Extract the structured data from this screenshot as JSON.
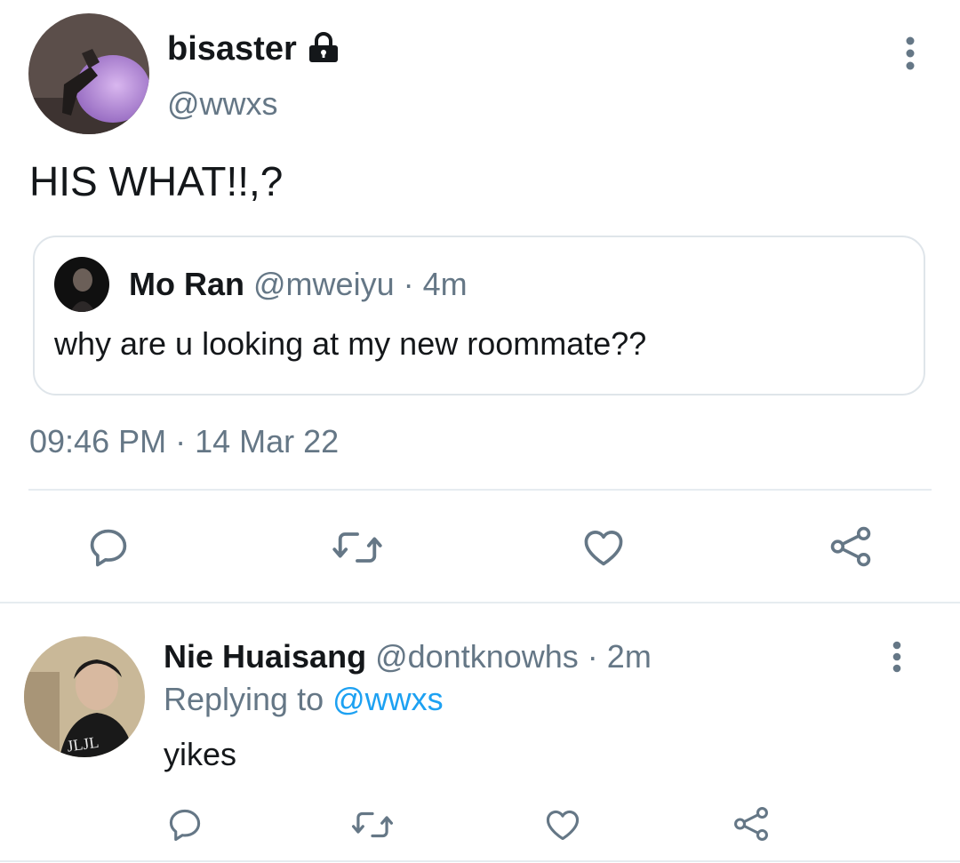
{
  "tweet": {
    "author_name": "bisaster",
    "author_handle": "@wwxs",
    "text": "HIS WHAT!!,?",
    "timestamp": "09:46 PM · 14 Mar 22",
    "quoted": {
      "name": "Mo Ran",
      "handle": "@mweiyu",
      "separator": "·",
      "time": "4m",
      "text": "why are u looking at my new roommate??"
    }
  },
  "reply": {
    "name": "Nie Huaisang",
    "handle": "@dontknowhs",
    "separator": "·",
    "time": "2m",
    "replying_prefix": "Replying to",
    "replying_to": "@wwxs",
    "text": "yikes"
  },
  "colors": {
    "text": "#14171a",
    "muted": "#657786",
    "link": "#1da1f2",
    "divider": "#e6ecf0"
  },
  "icons": [
    "lock-icon",
    "more-options-icon",
    "reply-icon",
    "retweet-icon",
    "like-icon",
    "share-icon"
  ]
}
